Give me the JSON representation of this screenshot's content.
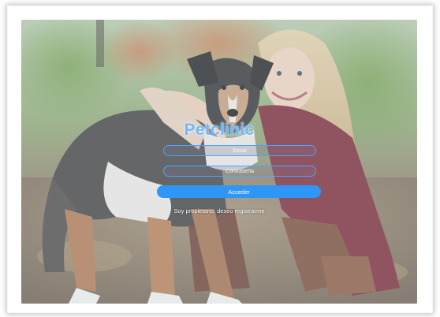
{
  "app": {
    "brand": "Petclinic"
  },
  "login": {
    "email_placeholder": "Email",
    "password_placeholder": "Contraseña",
    "submit_label": "Acceder",
    "register_link": "Soy propietario, deseo registrarme"
  },
  "colors": {
    "accent": "#2e96f7",
    "field_border": "#4da3ff",
    "brand_text": "#6fb8ff"
  },
  "icons": {
    "background": "photo-woman-with-dog"
  }
}
